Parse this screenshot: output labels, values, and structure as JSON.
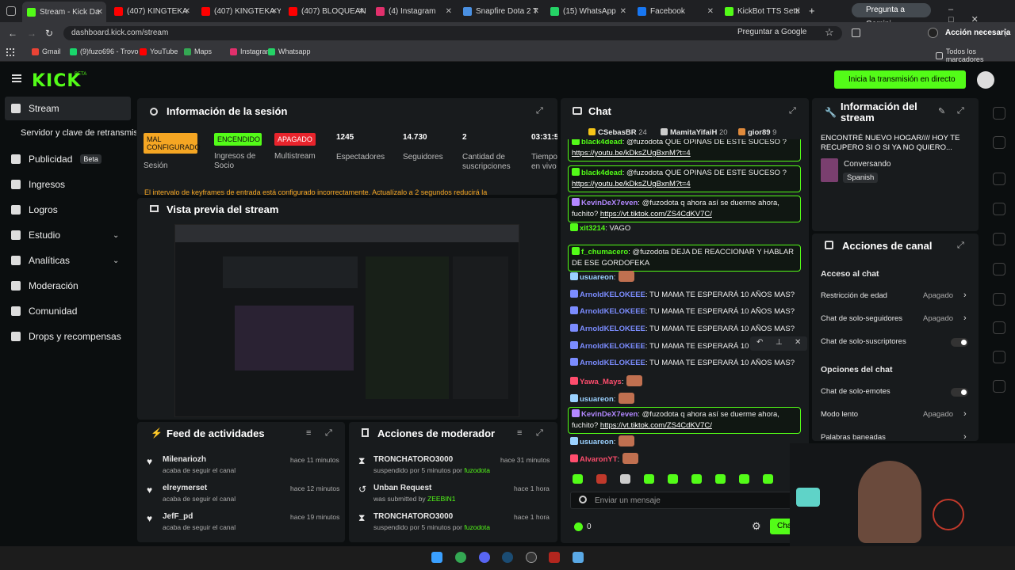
{
  "browser": {
    "tabs": [
      {
        "label": "Stream - Kick Da",
        "color": "#53fc18"
      },
      {
        "label": "(407) KINGTEKA",
        "color": "#ff0000"
      },
      {
        "label": "(407) KINGTEKA Y",
        "color": "#ff0000"
      },
      {
        "label": "(407) BLOQUEAN",
        "color": "#ff0000"
      },
      {
        "label": "(4) Instagram",
        "color": "#e1306c"
      },
      {
        "label": "Snapfire Dota 2 T",
        "color": "#4a90e2"
      },
      {
        "label": "(15) WhatsApp",
        "color": "#25d366"
      },
      {
        "label": "Facebook",
        "color": "#1877f2"
      },
      {
        "label": "KickBot TTS Setti",
        "color": "#53fc18"
      }
    ],
    "gemini": "Pregunta a Gemini",
    "url": "dashboard.kick.com/stream",
    "ask_google": "Preguntar a Google",
    "action_needed": "Acción necesaria",
    "bookmarks": [
      {
        "label": "Gmail",
        "color": "#ea4335"
      },
      {
        "label": "(9)fuzo696 - Trovo",
        "color": "#19d66b"
      },
      {
        "label": "YouTube",
        "color": "#ff0000"
      },
      {
        "label": "Maps",
        "color": "#34a853"
      },
      {
        "label": "Instagram",
        "color": "#e1306c"
      },
      {
        "label": "Whatsapp",
        "color": "#25d366"
      }
    ],
    "all_bookmarks": "Todos los marcadores"
  },
  "app": {
    "logo": "KICK",
    "beta": "BETA",
    "go_live": "Inicia la transmisión en directo",
    "accent": "#53fc18"
  },
  "sidebar": {
    "items": [
      {
        "label": "Stream",
        "icon": "stream-icon"
      },
      {
        "label": "Servidor y clave de retransmisión",
        "icon": ""
      },
      {
        "label": "Publicidad",
        "icon": "megaphone-icon",
        "badge": "Beta"
      },
      {
        "label": "Ingresos",
        "icon": "money-icon"
      },
      {
        "label": "Logros",
        "icon": "trophy-icon"
      },
      {
        "label": "Estudio",
        "icon": "studio-icon"
      },
      {
        "label": "Analíticas",
        "icon": "chart-icon"
      },
      {
        "label": "Moderación",
        "icon": "shield-icon"
      },
      {
        "label": "Comunidad",
        "icon": "community-icon"
      },
      {
        "label": "Drops y recompensas",
        "icon": "gift-icon"
      }
    ]
  },
  "session": {
    "title": "Información de la sesión",
    "stats": [
      {
        "value": "MAL CONFIGURADO",
        "label": "Sesión",
        "color": "#f5a623"
      },
      {
        "value": "ENCENDIDO",
        "label": "Ingresos de Socio",
        "color": "#53fc18"
      },
      {
        "value": "APAGADO",
        "label": "Multistream",
        "color": "#e8242c"
      },
      {
        "value": "1245",
        "label": "Espectadores"
      },
      {
        "value": "14.730",
        "label": "Seguidores"
      },
      {
        "value": "2",
        "label": "Cantidad de suscripciones"
      },
      {
        "value": "03:31:5",
        "label": "Tiempo en vivo"
      }
    ],
    "warning": "El intervalo de keyframes de entrada está configurado incorrectamente. Actualízalo a 2 segundos reducirá la"
  },
  "preview": {
    "title": "Vista previa del stream"
  },
  "activity": {
    "title": "Feed de actividades",
    "items": [
      {
        "user": "Milenariozh",
        "action": "acaba de seguir el canal",
        "time": "hace 11 minutos"
      },
      {
        "user": "elreymerset",
        "action": "acaba de seguir el canal",
        "time": "hace 12 minutos"
      },
      {
        "user": "JefF_pd",
        "action": "acaba de seguir el canal",
        "time": "hace 19 minutos"
      }
    ]
  },
  "modactions": {
    "title": "Acciones de moderador",
    "items": [
      {
        "user": "TRONCHATORO3000",
        "action": "suspendido por 5 minutos por",
        "by": "fuzodota",
        "time": "hace 31 minutos"
      },
      {
        "user": "Unban Request",
        "action": "was submitted by",
        "by": "ZEEBIN1",
        "time": "hace 1 hora"
      },
      {
        "user": "TRONCHATORO3000",
        "action": "suspendido por 5 minutos por",
        "by": "fuzodota",
        "time": "hace 1 hora"
      }
    ]
  },
  "chat": {
    "title": "Chat",
    "top": [
      {
        "user": "CSebasBR",
        "count": "24",
        "color": "#f5c518"
      },
      {
        "user": "MamitaYifaiH",
        "count": "20",
        "color": "#cccccc"
      },
      {
        "user": "gior89",
        "count": "9",
        "color": "#e08a3c"
      }
    ],
    "messages": [
      {
        "user": "black4dead",
        "text": ": @fuzodota QUE OPINAS DE ESTE SUCESO ?",
        "link": "https://youtu.be/kDksZUgBxnM?t=4",
        "color": "#53fc18",
        "hl": true
      },
      {
        "user": "black4dead",
        "text": ": @fuzodota QUE OPINAS DE ESTE SUCESO ?",
        "link": "https://youtu.be/kDksZUgBxnM?t=4",
        "color": "#53fc18",
        "hl": true
      },
      {
        "user": "KevinDeX7even",
        "text": ": @fuzodota q ahora así se duerme ahora, fuchito?",
        "link": "https://vt.tiktok.com/ZS4CdKV7C/",
        "color": "#b388ff",
        "hl": true
      },
      {
        "user": "xit3214",
        "text": ": VAGO",
        "link": "",
        "color": "#53fc18",
        "hl": false
      },
      {
        "user": "f_chumacero",
        "text": ": @fuzodota DEJA DE REACCIONAR Y HABLAR DE ESE GORDOFEKA",
        "link": "",
        "color": "#53fc18",
        "hl": true
      },
      {
        "user": "usuareon",
        "text": ":",
        "link": "",
        "color": "#9ad1ff",
        "hl": false
      },
      {
        "user": "ArnoldKELOKEEE",
        "text": ": TU MAMA TE ESPERARÁ 10 AÑOS MAS?",
        "link": "",
        "color": "#7b8cff",
        "hl": false
      },
      {
        "user": "ArnoldKELOKEEE",
        "text": ": TU MAMA TE ESPERARÁ 10 AÑOS MAS?",
        "link": "",
        "color": "#7b8cff",
        "hl": false
      },
      {
        "user": "ArnoldKELOKEEE",
        "text": ": TU MAMA TE ESPERARÁ 10 AÑOS MAS?",
        "link": "",
        "color": "#7b8cff",
        "hl": false
      },
      {
        "user": "ArnoldKELOKEEE",
        "text": ": TU MAMA TE ESPERARÁ 10 AN",
        "link": "",
        "color": "#7b8cff",
        "hl": false
      },
      {
        "user": "ArnoldKELOKEEE",
        "text": ": TU MAMA TE ESPERARÁ 10 AÑOS MAS?",
        "link": "",
        "color": "#7b8cff",
        "hl": false
      },
      {
        "user": "Yawa_Mays",
        "text": ":",
        "link": "",
        "color": "#ff4d6d",
        "hl": false
      },
      {
        "user": "usuareon",
        "text": ":",
        "link": "",
        "color": "#9ad1ff",
        "hl": false
      },
      {
        "user": "KevinDeX7even",
        "text": ": @fuzodota q ahora así se duerme ahora, fuchito?",
        "link": "https://vt.tiktok.com/ZS4CdKV7C/",
        "color": "#b388ff",
        "hl": true
      },
      {
        "user": "usuareon",
        "text": ":",
        "link": "",
        "color": "#9ad1ff",
        "hl": false
      },
      {
        "user": "AlvaronYT",
        "text": ":",
        "link": "",
        "color": "#ff4d6d",
        "hl": false
      }
    ],
    "input_placeholder": "Enviar un mensaje",
    "points": "0",
    "send": "Chat"
  },
  "info": {
    "title": "Información del stream",
    "stream_title": "ENCONTRÉ NUEVO HOGAR//// HOY TE RECUPERO SI O SI YA NO QUIERO...",
    "category": "Conversando",
    "language": "Spanish"
  },
  "channel": {
    "title": "Acciones de canal",
    "section1": "Acceso al chat",
    "rows": [
      {
        "label": "Restricción de edad",
        "value": "Apagado",
        "type": "arrow"
      },
      {
        "label": "Chat de solo-seguidores",
        "value": "Apagado",
        "type": "arrow"
      },
      {
        "label": "Chat de solo-suscriptores",
        "value": "",
        "type": "toggle"
      }
    ],
    "section2": "Opciones del chat",
    "rows2": [
      {
        "label": "Chat de solo-emotes",
        "value": "",
        "type": "toggle"
      },
      {
        "label": "Modo lento",
        "value": "Apagado",
        "type": "arrow"
      },
      {
        "label": "Palabras baneadas",
        "value": "",
        "type": "arrow"
      }
    ]
  }
}
